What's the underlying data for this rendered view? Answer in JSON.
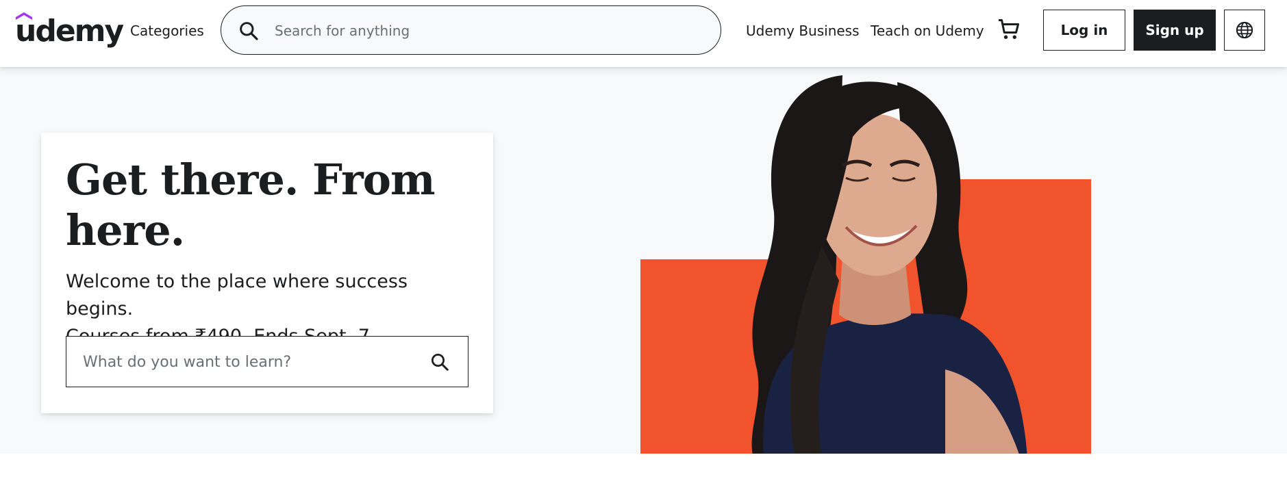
{
  "header": {
    "logo_text": "udemy",
    "categories_label": "Categories",
    "search_placeholder": "Search for anything",
    "business_label": "Udemy Business",
    "teach_label": "Teach on Udemy",
    "login_label": "Log in",
    "signup_label": "Sign up",
    "icons": [
      "search-icon",
      "cart-icon",
      "globe-icon"
    ]
  },
  "hero": {
    "headline": "Get there. From here.",
    "subtitle_line1": "Welcome to the place where success begins.",
    "subtitle_line2": "Courses from ₹490. Ends Sept. 7",
    "search_placeholder": "What do you want to learn?"
  },
  "colors": {
    "brand_purple": "#a435f0",
    "accent_orange": "#f1532c",
    "text_dark": "#1c1d1f",
    "hero_bg": "#f7f9fa"
  }
}
